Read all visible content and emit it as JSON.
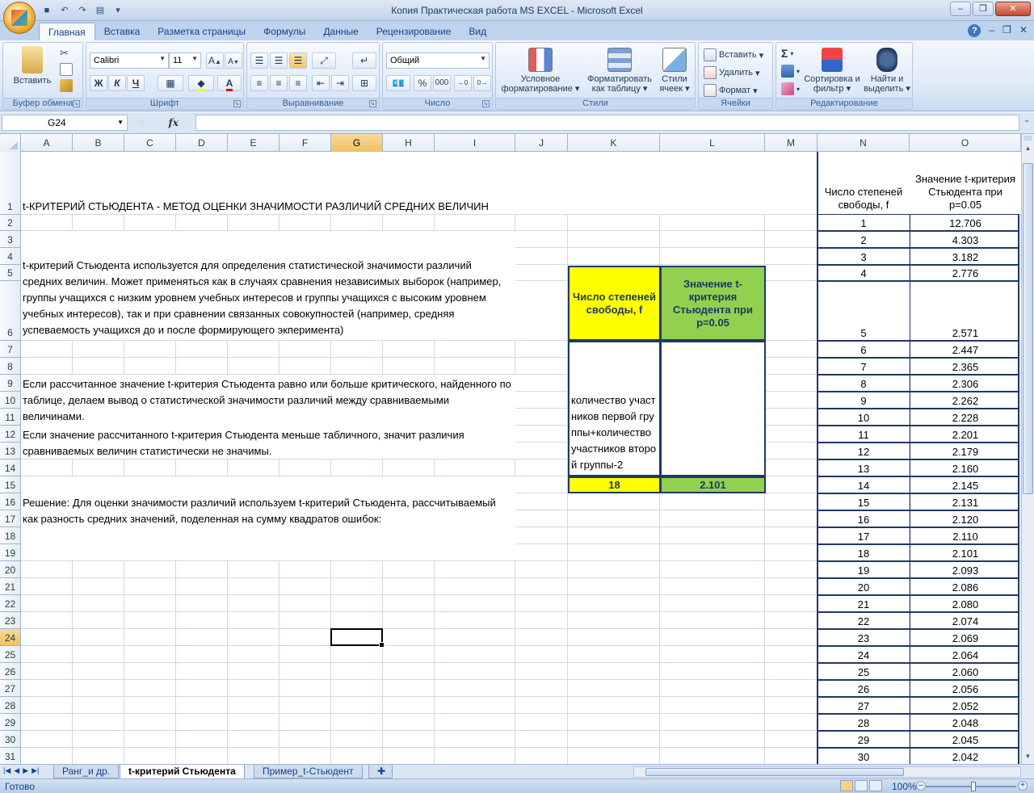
{
  "window": {
    "title": "Копия Практическая работа MS EXCEL - Microsoft Excel"
  },
  "ribbon": {
    "tabs": [
      "Главная",
      "Вставка",
      "Разметка страницы",
      "Формулы",
      "Данные",
      "Рецензирование",
      "Вид"
    ],
    "active_tab": "Главная",
    "groups": {
      "clipboard": {
        "label": "Буфер обмена",
        "paste": "Вставить"
      },
      "font": {
        "label": "Шрифт",
        "font_name": "Calibri",
        "font_size": "11",
        "bold": "Ж",
        "italic": "К",
        "underline": "Ч"
      },
      "alignment": {
        "label": "Выравнивание"
      },
      "number": {
        "label": "Число",
        "format": "Общий",
        "percent": "%",
        "thousands": "000"
      },
      "styles": {
        "label": "Стили",
        "conditional": "Условное форматирование",
        "as_table": "Форматировать как таблицу",
        "cell_styles": "Стили ячеек"
      },
      "cells": {
        "label": "Ячейки",
        "insert": "Вставить",
        "delete": "Удалить",
        "format": "Формат"
      },
      "editing": {
        "label": "Редактирование",
        "sum": "Σ",
        "sort": "Сортировка и фильтр",
        "find": "Найти и выделить"
      }
    }
  },
  "formula_bar": {
    "name_box": "G24",
    "fx": "fx",
    "formula": ""
  },
  "columns": [
    "A",
    "B",
    "C",
    "D",
    "E",
    "F",
    "G",
    "H",
    "I",
    "J",
    "K",
    "L",
    "M",
    "N",
    "O"
  ],
  "rows": [
    "1",
    "2",
    "3",
    "4",
    "5",
    "6",
    "7",
    "8",
    "9",
    "10",
    "11",
    "12",
    "13",
    "14",
    "15",
    "16",
    "17",
    "18",
    "19",
    "20",
    "21",
    "22",
    "23",
    "24",
    "25",
    "26",
    "27",
    "28",
    "29",
    "30",
    "31"
  ],
  "sheet": {
    "title": "t-КРИТЕРИЙ СТЬЮДЕНТА - МЕТОД ОЦЕНКИ ЗНАЧИМОСТИ РАЗЛИЧИЙ СРЕДНИХ ВЕЛИЧИН",
    "para1": "t-критерий Стьюдента используется для определения статистической значимости различий средних величин. Может применяться как в случаях сравнения независимых выборок (например, группы учащихся с низким уровнем учебных интересов и группы учащихся с высоким уровнем учебных интересов), так и при сравнении связанных совокупностей (например, средняя успеваемость учащихся до и после формирующего экперимента)",
    "para2": "Если рассчитанное значение t-критерия Стьюдента равно или больше критического, найденного по таблице, делаем вывод о статистической значимости различий между сравниваемыми величинами.",
    "para3": "Если значение рассчитанного t-критерия Стьюдента меньше табличного, значит различия сравниваемых величин статистически не значимы.",
    "para4": "Решение: Для оценки значимости различий используем t-критерий Стьюдента, рассчитываемый как разность средних значений, поделенная на сумму квадратов ошибок:",
    "kl_table": {
      "k_header": "Число степеней свободы, f",
      "l_header": "Значение t-критерия Стьюдента при p=0.05",
      "k_note": "количество участников первой группы+количество участников второй группы-2",
      "k_value": "18",
      "l_value": "2.101"
    },
    "no_table": {
      "n_header": "Число степеней свободы, f",
      "o_header": "Значение t-критерия Стьюдента при p=0.05",
      "f": [
        "1",
        "2",
        "3",
        "4",
        "5",
        "6",
        "7",
        "8",
        "9",
        "10",
        "11",
        "12",
        "13",
        "14",
        "15",
        "16",
        "17",
        "18",
        "19",
        "20",
        "21",
        "22",
        "23",
        "24",
        "25",
        "26",
        "27",
        "28",
        "29",
        "30"
      ],
      "t": [
        "12.706",
        "4.303",
        "3.182",
        "2.776",
        "2.571",
        "2.447",
        "2.365",
        "2.306",
        "2.262",
        "2.228",
        "2.201",
        "2.179",
        "2.160",
        "2.145",
        "2.131",
        "2.120",
        "2.110",
        "2.101",
        "2.093",
        "2.086",
        "2.080",
        "2.074",
        "2.069",
        "2.064",
        "2.060",
        "2.056",
        "2.052",
        "2.048",
        "2.045",
        "2.042"
      ]
    }
  },
  "sheet_tabs": [
    "Ранг_и др.",
    "t-критерий Стьюдента",
    "Пример_t-Стьюдент"
  ],
  "active_sheet": "t-критерий Стьюдента",
  "status": {
    "ready": "Готово",
    "zoom": "100%"
  },
  "colors": {
    "yellow": "#ffff00",
    "green": "#92d050",
    "border": "#1f3864"
  }
}
